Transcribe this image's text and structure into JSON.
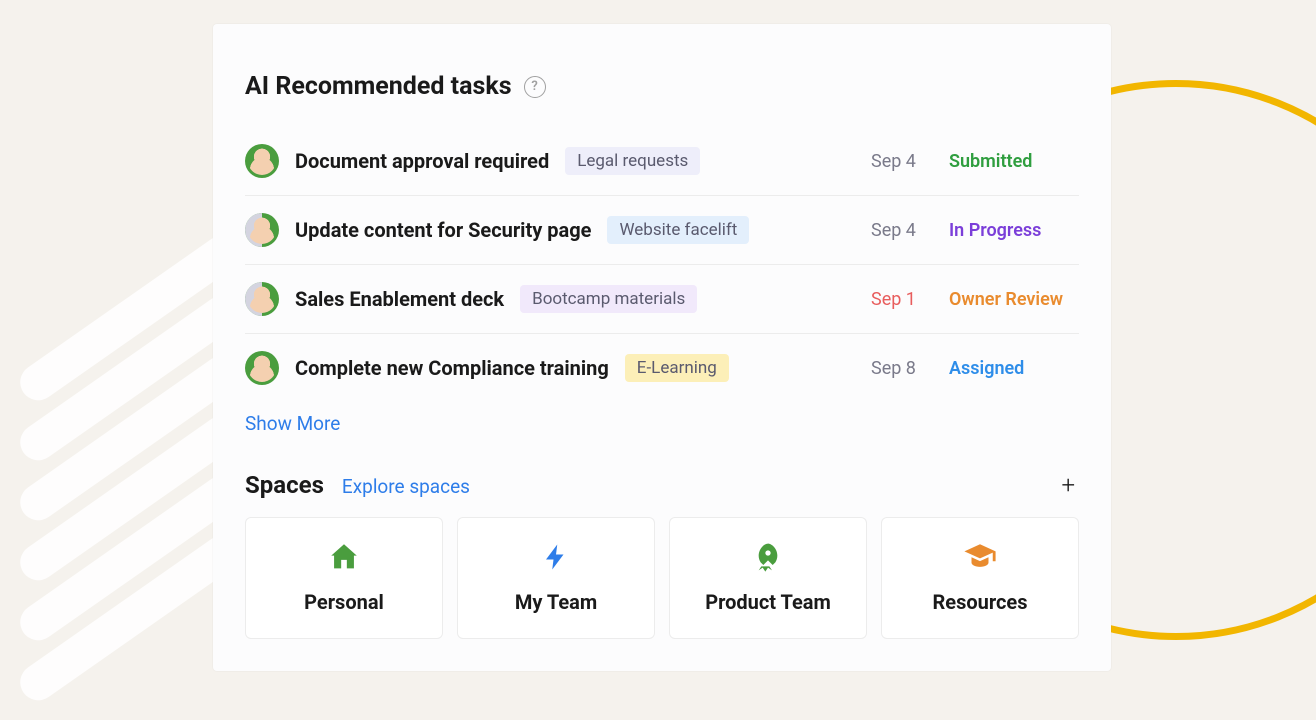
{
  "tasks_section": {
    "title": "AI Recommended tasks",
    "help_glyph": "?",
    "show_more": "Show More"
  },
  "tasks": [
    {
      "title": "Document approval required",
      "tag": "Legal requests",
      "tag_bg": "#eeeefa",
      "date": "Sep 4",
      "date_overdue": false,
      "status": "Submitted",
      "status_color": "#2f9e3f",
      "avatar_split": false
    },
    {
      "title": "Update content for Security page",
      "tag": "Website facelift",
      "tag_bg": "#e3effc",
      "date": "Sep 4",
      "date_overdue": false,
      "status": "In Progress",
      "status_color": "#7b3ed9",
      "avatar_split": true
    },
    {
      "title": "Sales Enablement deck",
      "tag": "Bootcamp materials",
      "tag_bg": "#f1e9fb",
      "date": "Sep 1",
      "date_overdue": true,
      "status": "Owner Review",
      "status_color": "#e98b2e",
      "avatar_split": true
    },
    {
      "title": "Complete new Compliance training",
      "tag": "E-Learning",
      "tag_bg": "#fcefb8",
      "date": "Sep 8",
      "date_overdue": false,
      "status": "Assigned",
      "status_color": "#2e8de9",
      "avatar_split": false
    }
  ],
  "spaces_section": {
    "title": "Spaces",
    "explore": "Explore spaces"
  },
  "spaces": [
    {
      "label": "Personal",
      "icon": "house",
      "color": "#4a9d3e"
    },
    {
      "label": "My Team",
      "icon": "bolt",
      "color": "#2e7de9"
    },
    {
      "label": "Product Team",
      "icon": "rocket",
      "color": "#4a9d3e"
    },
    {
      "label": "Resources",
      "icon": "grad",
      "color": "#e98b2e"
    }
  ]
}
